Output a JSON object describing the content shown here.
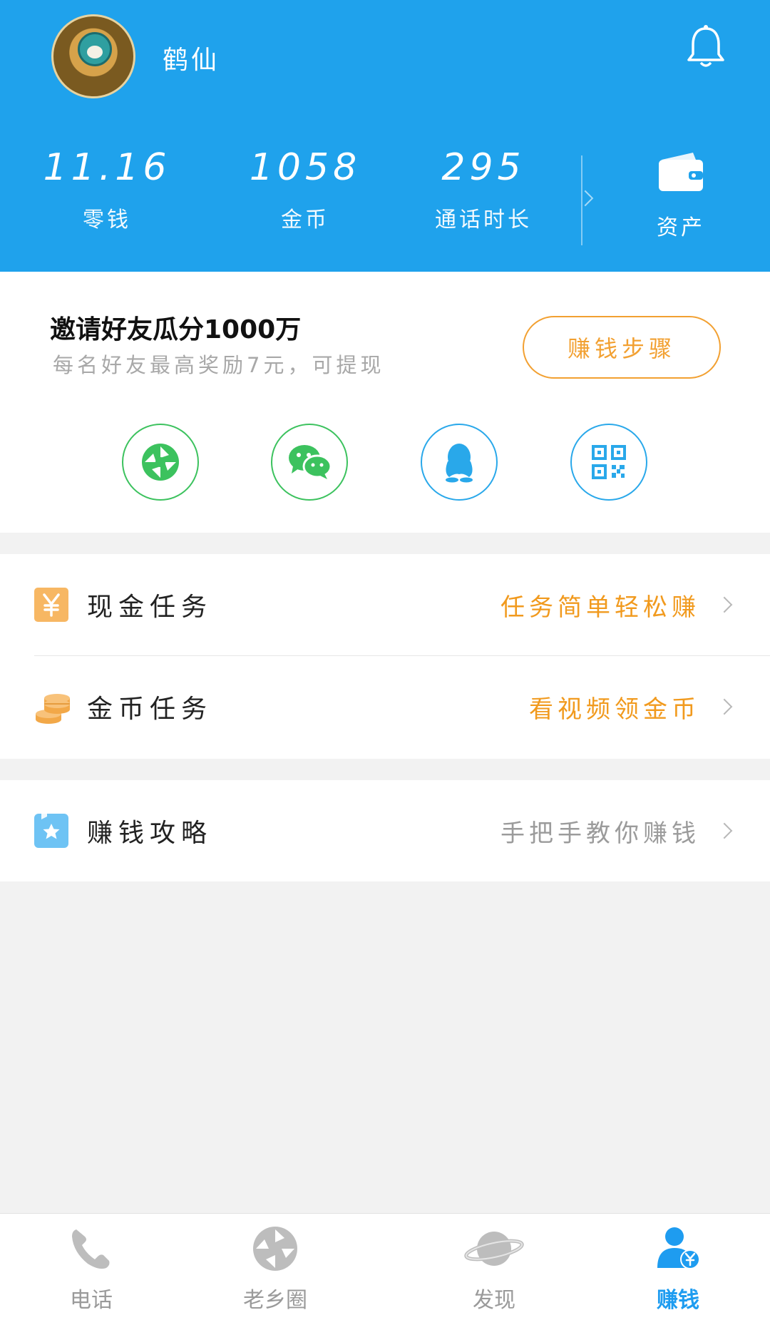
{
  "header": {
    "username": "鹤仙",
    "stats": [
      {
        "value": "11.16",
        "label": "零钱"
      },
      {
        "value": "1058",
        "label": "金币"
      },
      {
        "value": "295",
        "label": "通话时长"
      }
    ],
    "asset_label": "资产"
  },
  "invite": {
    "title": "邀请好友瓜分1000万",
    "subtitle": "每名好友最高奖励7元，可提现",
    "steps_button": "赚钱步骤",
    "share_icons": [
      "moments-icon",
      "wechat-icon",
      "qq-icon",
      "qrcode-icon"
    ]
  },
  "tasks": [
    {
      "title": "现金任务",
      "hint": "任务简单轻松赚",
      "icon": "yuan-icon"
    },
    {
      "title": "金币任务",
      "hint": "看视频领金币",
      "icon": "coins-icon"
    }
  ],
  "guide": {
    "title": "赚钱攻略",
    "hint": "手把手教你赚钱",
    "icon": "star-bookmark-icon"
  },
  "nav": [
    {
      "label": "电话",
      "icon": "phone-icon"
    },
    {
      "label": "老乡圈",
      "icon": "aperture-icon"
    },
    {
      "label": "发现",
      "icon": "planet-icon"
    },
    {
      "label": "赚钱",
      "icon": "earn-user-icon",
      "active": true
    }
  ],
  "colors": {
    "header_bg": "#1fa2ec",
    "accent_orange": "#f19a1e",
    "share_green": "#3cc25e",
    "share_blue": "#29a8ea",
    "nav_active": "#1e9cf0"
  }
}
